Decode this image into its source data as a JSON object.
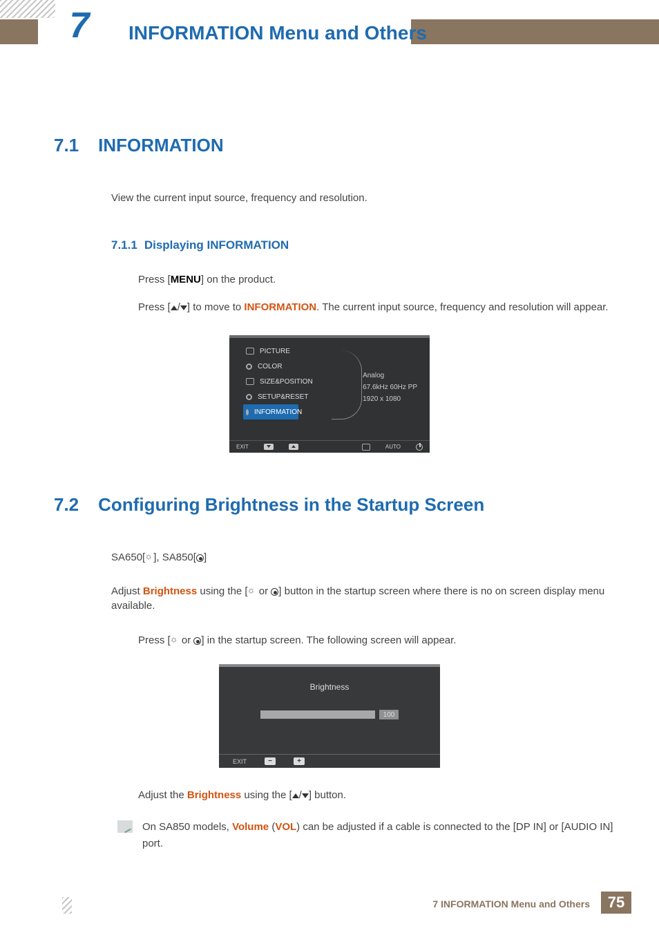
{
  "header": {
    "chapter_num": "7",
    "chapter_title": "INFORMATION Menu and Others"
  },
  "s71": {
    "num": "7.1",
    "title": "INFORMATION",
    "intro": "View the current input source, frequency and resolution."
  },
  "s711": {
    "num": "7.1.1",
    "title": "Displaying INFORMATION",
    "step1_a": "Press [",
    "step1_menu": "MENU",
    "step1_b": "] on the product.",
    "step2_a": "Press [",
    "step2_b": "] to move to ",
    "step2_info": "INFORMATION",
    "step2_c": ". The current input source, frequency and resolution will appear."
  },
  "osd1": {
    "items": [
      "PICTURE",
      "COLOR",
      "SIZE&POSITION",
      "SETUP&RESET",
      "INFORMATION"
    ],
    "info_source": "Analog",
    "info_freq": "67.6kHz 60Hz PP",
    "info_res": "1920 x 1080",
    "exit": "EXIT",
    "auto": "AUTO"
  },
  "s72": {
    "num": "7.2",
    "title": "Configuring Brightness in the Startup Screen",
    "models_a": "SA650[",
    "models_b": "], SA850[",
    "models_c": "]",
    "para1_a": "Adjust ",
    "para1_bright": "Brightness",
    "para1_b": " using the [",
    "para1_c": " or ",
    "para1_d": "] button in the startup screen where there is no on screen display menu available.",
    "step_a": "Press [",
    "step_b": " or ",
    "step_c": "] in the startup screen. The following screen will appear."
  },
  "osd2": {
    "title": "Brightness",
    "value": "100",
    "exit": "EXIT"
  },
  "after_osd2_a": "Adjust the ",
  "after_osd2_bright": "Brightness",
  "after_osd2_b": " using the [",
  "after_osd2_c": "] button.",
  "note_a": "On SA850 models, ",
  "note_vol": "Volume",
  "note_paren_a": " (",
  "note_volshort": "VOL",
  "note_paren_b": ") can be adjusted if a cable is connected to the [DP IN] or [AUDIO IN] port.",
  "footer": {
    "text": "7 INFORMATION Menu and Others",
    "page": "75"
  }
}
